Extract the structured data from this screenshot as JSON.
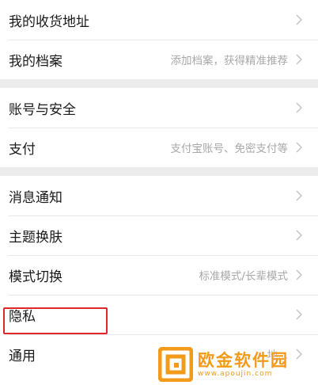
{
  "groups": [
    {
      "items": [
        {
          "label": "我的收货地址",
          "hint": ""
        },
        {
          "label": "我的档案",
          "hint": "添加档案，获得精准推荐"
        }
      ]
    },
    {
      "items": [
        {
          "label": "账号与安全",
          "hint": ""
        },
        {
          "label": "支付",
          "hint": "支付宝账号、免密支付等"
        }
      ]
    },
    {
      "items": [
        {
          "label": "消息通知",
          "hint": ""
        },
        {
          "label": "主题换肤",
          "hint": ""
        },
        {
          "label": "模式切换",
          "hint": "标准模式/长辈模式"
        },
        {
          "label": "隐私",
          "hint": ""
        },
        {
          "label": "通用",
          "hint": "地..."
        }
      ]
    }
  ],
  "watermark": {
    "name": "欧金软件园",
    "url": "www.apoujin.com"
  },
  "colors": {
    "highlight": "#e02626",
    "watermark": "#f29a1a",
    "separator": "#ececec"
  },
  "icons": {
    "chevron": "chevron-right-icon",
    "watermark_logo": "watermark-logo-icon"
  }
}
